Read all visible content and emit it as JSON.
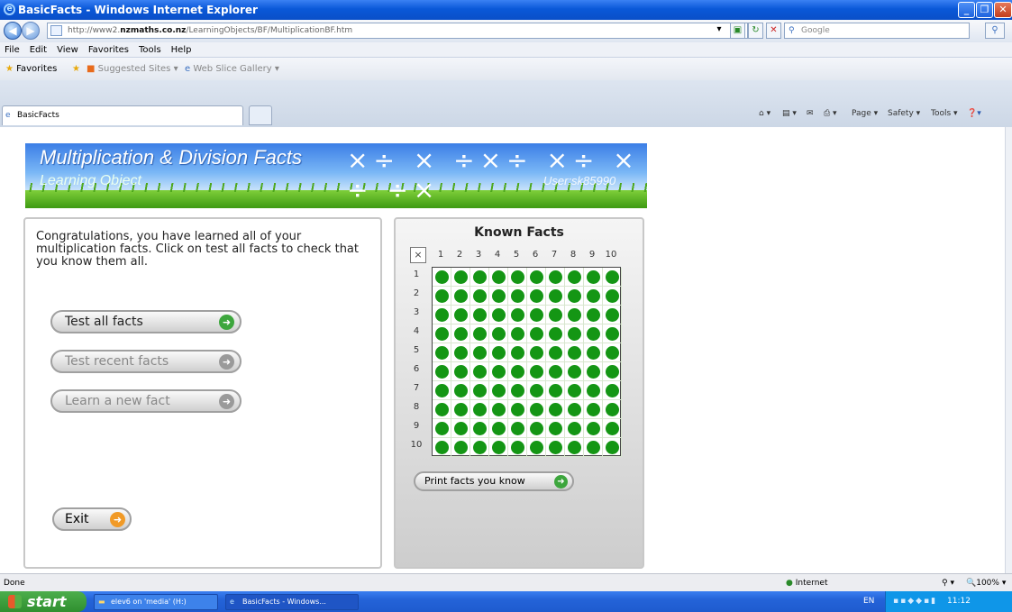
{
  "window": {
    "title": "BasicFacts - Windows Internet Explorer"
  },
  "address_bar": {
    "url_prefix": "http://www2.",
    "url_host": "nzmaths.co.nz",
    "url_path": "/LearningObjects/BF/MultiplicationBF.htm",
    "search_placeholder": "Google"
  },
  "menu": [
    "File",
    "Edit",
    "View",
    "Favorites",
    "Tools",
    "Help"
  ],
  "favorites_bar": {
    "favorites": "Favorites",
    "suggested": "Suggested Sites ▾",
    "gallery": "Web Slice Gallery ▾"
  },
  "tab": {
    "label": "BasicFacts"
  },
  "command_bar": [
    "Page ▾",
    "Safety ▾",
    "Tools ▾"
  ],
  "banner": {
    "title": "Multiplication & Division Facts",
    "subtitle": "Learning Object",
    "user": "User:sk85990",
    "symbols": "×÷ × ÷×÷ ×÷ × ÷ ÷×"
  },
  "left_panel": {
    "message": "Congratulations, you have learned all of your multiplication facts.  Click on test all facts to check that you know them all.",
    "buttons": [
      {
        "label": "Test all facts",
        "enabled": true
      },
      {
        "label": "Test recent facts",
        "enabled": false
      },
      {
        "label": "Learn a new fact",
        "enabled": false
      }
    ],
    "exit_label": "Exit"
  },
  "known_facts": {
    "title": "Known Facts",
    "corner": "×",
    "columns": [
      "1",
      "2",
      "3",
      "4",
      "5",
      "6",
      "7",
      "8",
      "9",
      "10"
    ],
    "rows": [
      "1",
      "2",
      "3",
      "4",
      "5",
      "6",
      "7",
      "8",
      "9",
      "10"
    ],
    "known_color": "#149614",
    "print_label": "Print facts you know"
  },
  "status": {
    "left": "Done",
    "zone": "Internet",
    "zoom": "100%"
  },
  "taskbar": {
    "start": "start",
    "task1": "elev6 on 'media' (H:)",
    "task2": "BasicFacts - Windows...",
    "lang": "EN",
    "clock": "11:12"
  }
}
